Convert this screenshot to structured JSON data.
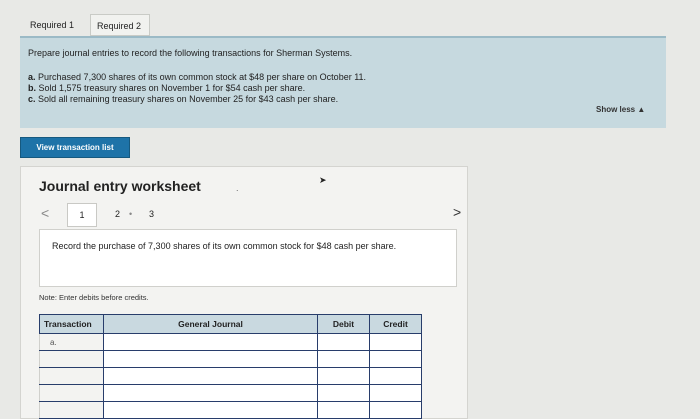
{
  "tabs": [
    {
      "label": "Required 1"
    },
    {
      "label": "Required 2"
    }
  ],
  "panel": {
    "intro": "Prepare journal entries to record the following transactions for Sherman Systems.",
    "items": [
      {
        "letter": "a.",
        "text": "Purchased 7,300 shares of its own common stock at $48 per share on October 11."
      },
      {
        "letter": "b.",
        "text": "Sold 1,575 treasury shares on November 1 for $54 cash per share."
      },
      {
        "letter": "c.",
        "text": "Sold all remaining treasury shares on November 25 for $43 cash per share."
      }
    ],
    "show_less": "Show less ▲"
  },
  "view_button": "View transaction list",
  "worksheet": {
    "title": "Journal entry worksheet",
    "dot": ".",
    "prev": "<",
    "next": ">",
    "pages": [
      "1",
      "2",
      "3"
    ],
    "page_sep": "•",
    "description": "Record the purchase of 7,300 shares of its own common stock for $48 cash per share.",
    "note": "Note: Enter debits before credits.",
    "columns": [
      "Transaction",
      "General Journal",
      "Debit",
      "Credit"
    ],
    "rows": [
      {
        "transaction": "a.",
        "account": "",
        "debit": "",
        "credit": ""
      },
      {
        "transaction": "",
        "account": "",
        "debit": "",
        "credit": ""
      },
      {
        "transaction": "",
        "account": "",
        "debit": "",
        "credit": ""
      },
      {
        "transaction": "",
        "account": "",
        "debit": "",
        "credit": ""
      },
      {
        "transaction": "",
        "account": "",
        "debit": "",
        "credit": ""
      }
    ]
  }
}
